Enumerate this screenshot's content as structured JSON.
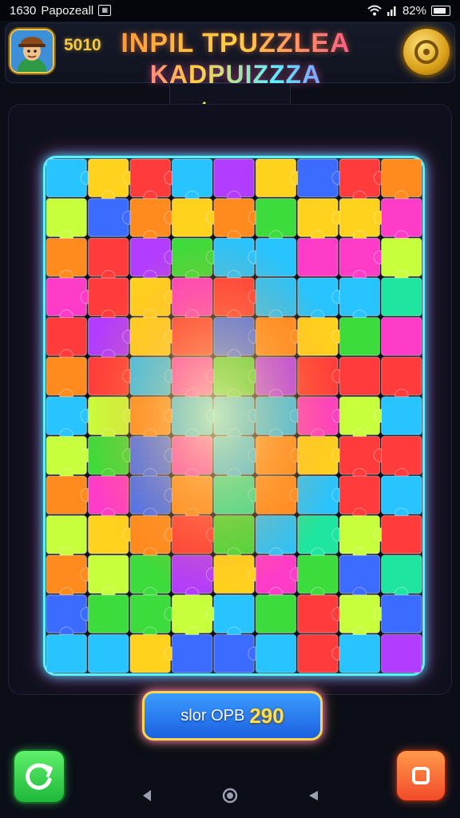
{
  "status_bar": {
    "time": "1630",
    "app_label": "Papozeall",
    "battery": "82%",
    "icons": [
      "notification-icon",
      "wifi-icon",
      "signal-icon",
      "battery-icon"
    ]
  },
  "header": {
    "score": "5010",
    "title_line1": "INPIL TPUZZLEA",
    "title_line2": "KADPUIZZZA",
    "avatar": "avatar-icon",
    "coin_icon": "coin-icon"
  },
  "board": {
    "border_color": "#5af2ff",
    "glow_color": "#ff3cc8",
    "piece_colors": [
      "#ff3b3b",
      "#ff8a1e",
      "#ffd21e",
      "#3cdc3c",
      "#27c4ff",
      "#3c6cff",
      "#b23cff",
      "#ff3cc8",
      "#1ee6a0",
      "#c8ff3c"
    ]
  },
  "score_button": {
    "label": "slor OPB",
    "value": "290"
  },
  "bottom_buttons": {
    "left_icon": "refresh-icon",
    "right_icon": "stop-icon"
  },
  "nav": {
    "back_icon": "back-icon",
    "home_icon": "home-icon",
    "recent_icon": "recent-icon"
  }
}
